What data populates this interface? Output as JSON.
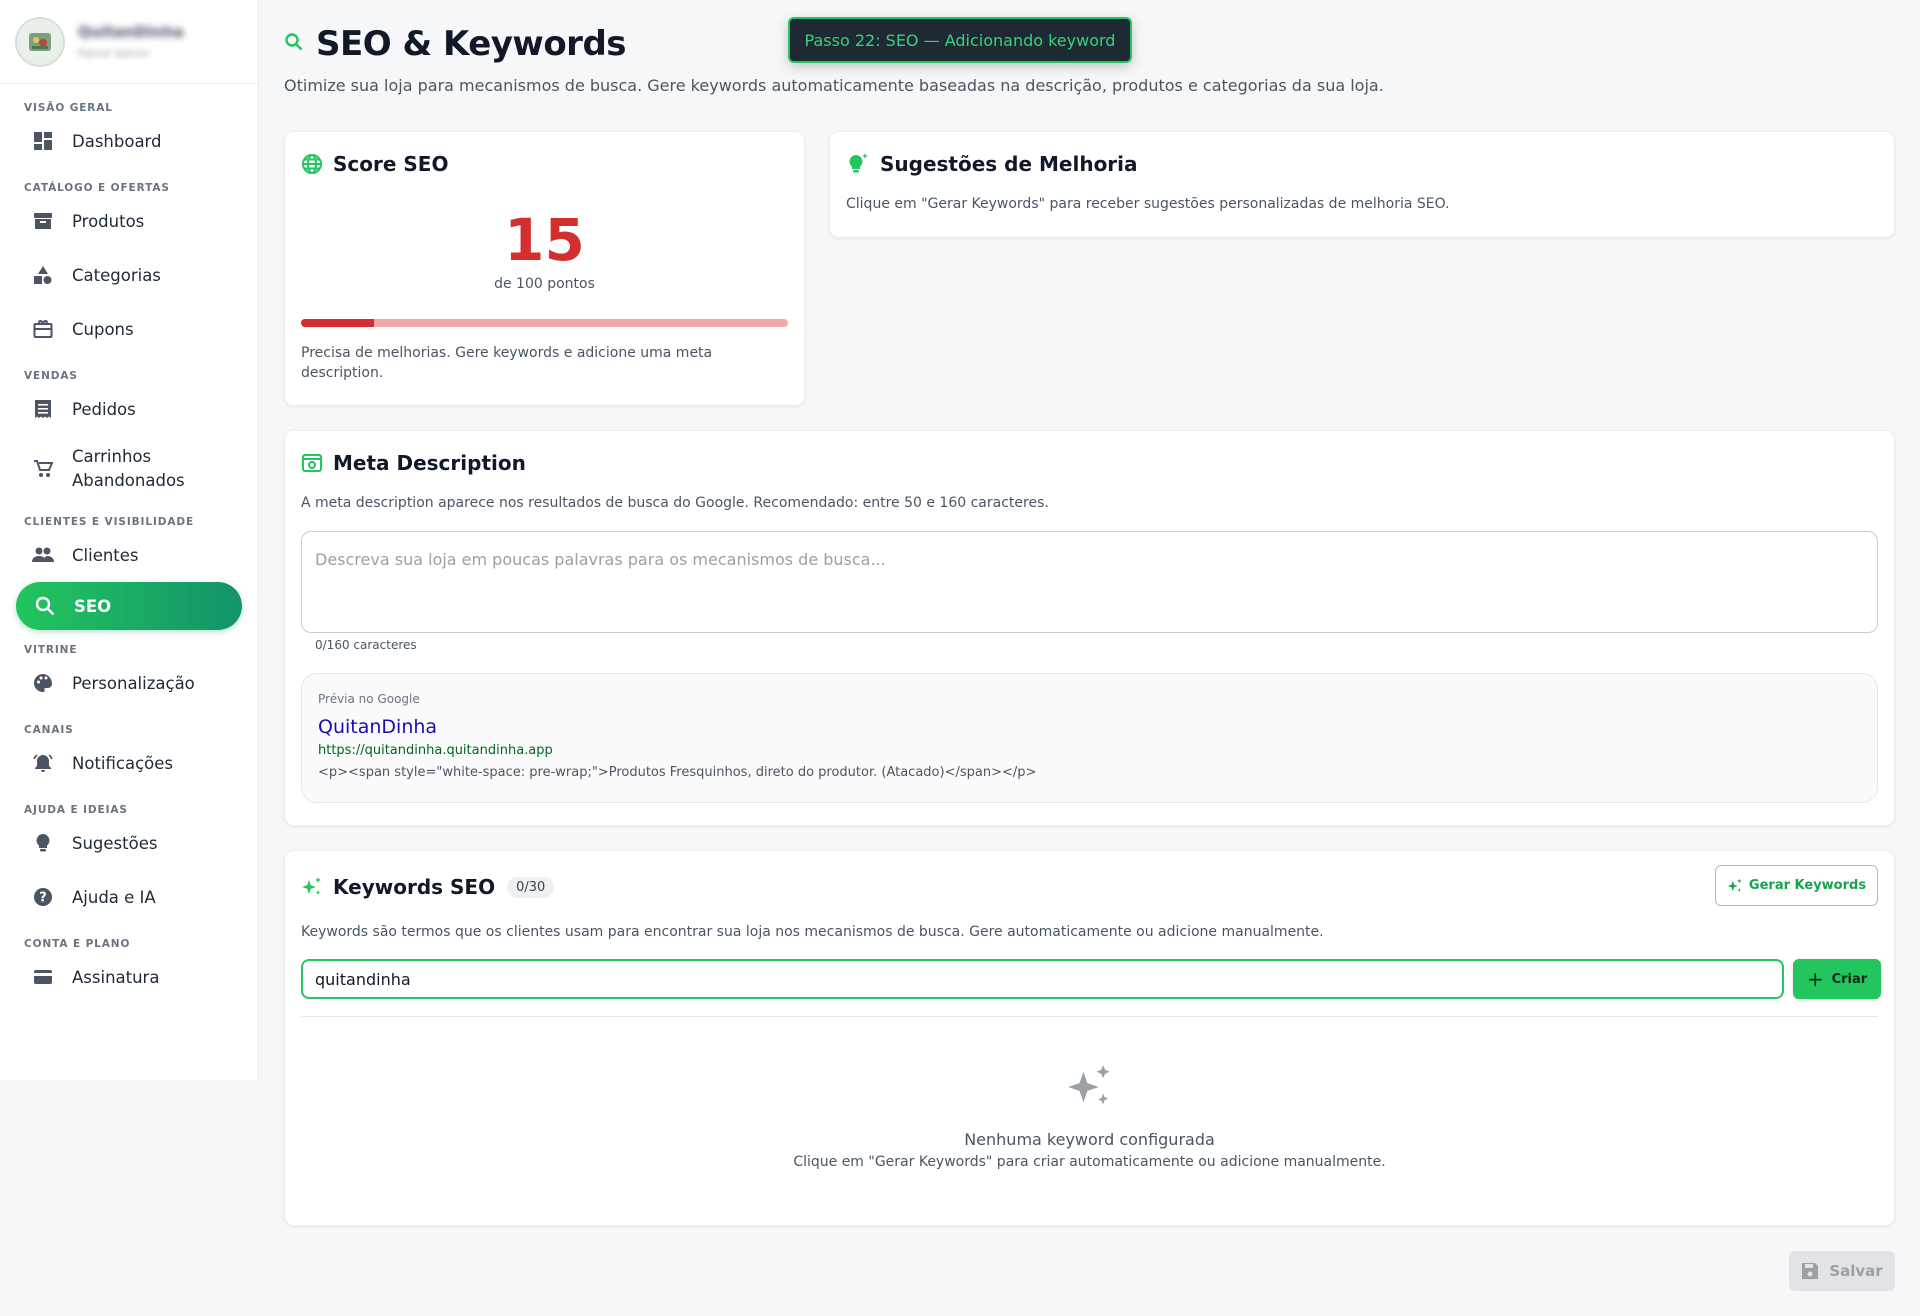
{
  "sidebar": {
    "user": {
      "name": "QuitanDinha",
      "subtitle": "Painel Admin",
      "avatar_icon": "store-logo-icon"
    },
    "sections": [
      {
        "label": "Visão Geral"
      },
      {
        "label": "Catálogo e Ofertas"
      },
      {
        "label": "Vendas"
      },
      {
        "label": "Clientes e Visibilidade"
      },
      {
        "label": "Vitrine"
      },
      {
        "label": "Canais"
      },
      {
        "label": "Ajuda e Ideias"
      },
      {
        "label": "Conta e Plano"
      }
    ],
    "items": {
      "dashboard": {
        "label": "Dashboard",
        "icon": "dashboard-icon"
      },
      "produtos": {
        "label": "Produtos",
        "icon": "archive-icon"
      },
      "categorias": {
        "label": "Categorias",
        "icon": "shapes-icon"
      },
      "cupons": {
        "label": "Cupons",
        "icon": "gift-card-icon"
      },
      "pedidos": {
        "label": "Pedidos",
        "icon": "receipt-icon"
      },
      "carrinhos_1": {
        "label": "Carrinhos"
      },
      "carrinhos_2": {
        "label": "Abandonados"
      },
      "clientes": {
        "label": "Clientes",
        "icon": "people-icon"
      },
      "seo": {
        "label": "SEO",
        "icon": "search-icon",
        "active": true
      },
      "personalizacao": {
        "label": "Personalização",
        "icon": "palette-icon"
      },
      "notificacoes": {
        "label": "Notificações",
        "icon": "bell-icon"
      },
      "sugestoes": {
        "label": "Sugestões",
        "icon": "lightbulb-icon"
      },
      "ajuda": {
        "label": "Ajuda e IA",
        "icon": "help-icon"
      },
      "assinatura": {
        "label": "Assinatura",
        "icon": "credit-card-icon"
      }
    }
  },
  "toast": {
    "text": "Passo 22: SEO — Adicionando keyword"
  },
  "header": {
    "title": "SEO & Keywords",
    "subtitle": "Otimize sua loja para mecanismos de busca. Gere keywords automaticamente baseadas na descrição, produtos e categorias da sua loja."
  },
  "score": {
    "title": "Score SEO",
    "value": "15",
    "of_label": "de 100 pontos",
    "progress": 0.15,
    "note": "Precisa de melhorias. Gere keywords e adicione uma meta description."
  },
  "suggestions": {
    "title": "Sugestões de Melhoria",
    "text": "Clique em \"Gerar Keywords\" para receber sugestões personalizadas de melhoria SEO."
  },
  "meta": {
    "title": "Meta Description",
    "help": "A meta description aparece nos resultados de busca do Google. Recomendado: entre 50 e 160 caracteres.",
    "placeholder": "Descreva sua loja em poucas palavras para os mecanismos de busca...",
    "char_count": "0/160 caracteres",
    "preview": {
      "label": "Prévia no Google",
      "title": "QuitanDinha",
      "url": "https://quitandinha.quitandinha.app",
      "description": "<p><span style=\"white-space: pre-wrap;\">Produtos Fresquinhos, direto do produtor. (Atacado)</span></p>"
    }
  },
  "keywords": {
    "title": "Keywords SEO",
    "count_badge": "0/30",
    "generate_label": "Gerar Keywords",
    "help": "Keywords são termos que os clientes usam para encontrar sua loja nos mecanismos de busca. Gere automaticamente ou adicione manualmente.",
    "input_value": "quitandinha",
    "create_label": "Criar",
    "empty_title": "Nenhuma keyword configurada",
    "empty_sub": "Clique em \"Gerar Keywords\" para criar automaticamente ou adicione manualmente."
  },
  "footer": {
    "save_label": "Salvar"
  },
  "colors": {
    "accent": "#22c55e",
    "score_red": "#d32f2f",
    "toast_bg": "#1e2a33"
  }
}
